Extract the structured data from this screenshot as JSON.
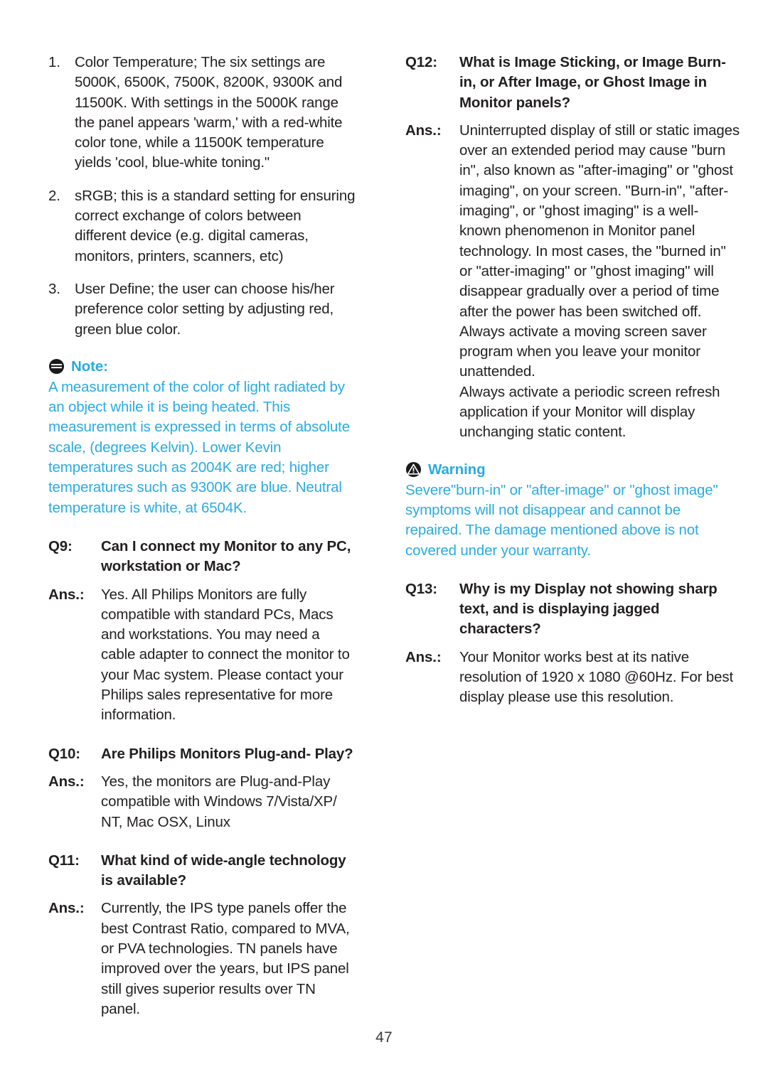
{
  "page": {
    "number": "47",
    "accent_color": "#29abe2",
    "text_color": "#231f20"
  },
  "left_column": {
    "numbered_list": [
      {
        "num": "1.",
        "text": "Color Temperature; The six settings are 5000K, 6500K, 7500K, 8200K, 9300K and 11500K. With settings in the 5000K range the panel appears 'warm,' with a red-white color tone, while a 11500K temperature yields 'cool, blue-white toning.\""
      },
      {
        "num": "2.",
        "text": "sRGB; this is a standard setting for ensuring correct exchange of colors between different device (e.g. digital cameras, monitors, printers, scanners, etc)"
      },
      {
        "num": "3.",
        "text": "User Define; the user can choose his/her preference color setting by adjusting red, green blue color."
      }
    ],
    "note": {
      "icon": "note-icon",
      "title": "Note:",
      "body": "A measurement of the color of light radiated by an object while it is being heated. This measurement is expressed in terms of absolute scale, (degrees Kelvin). Lower Kevin temperatures such as 2004K are red; higher temperatures such as 9300K are blue. Neutral temperature is white, at 6504K."
    },
    "qa": [
      {
        "q_label": "Q9:",
        "q_text": "Can I connect my Monitor to any PC, workstation or Mac?",
        "a_label": "Ans.:",
        "a_paragraphs": [
          "Yes. All Philips Monitors are fully compatible with standard PCs, Macs and workstations. You may need a cable adapter to connect the monitor to your Mac system. Please contact your Philips sales representative for more information."
        ]
      },
      {
        "q_label": "Q10:",
        "q_text": "Are Philips Monitors Plug-and- Play?",
        "a_label": "Ans.:",
        "a_paragraphs": [
          "Yes, the monitors are Plug-and-Play compatible with Windows 7/Vista/XP/ NT, Mac OSX, Linux"
        ]
      },
      {
        "q_label": "Q11:",
        "q_text": "What kind of wide-angle technology is available?",
        "a_label": "Ans.:",
        "a_paragraphs": [
          "Currently, the IPS type panels offer the best Contrast Ratio, compared to MVA, or PVA technologies. TN panels have improved over the years, but IPS panel still gives superior results over TN panel."
        ]
      }
    ]
  },
  "right_column": {
    "qa_top": {
      "q_label": "Q12:",
      "q_text": "What is Image Sticking, or Image Burn-in, or After Image, or Ghost Image in Monitor panels?",
      "a_label": "Ans.:",
      "a_paragraphs": [
        "Uninterrupted display of still or static images over an extended period may cause \"burn in\", also known as \"after-imaging\" or \"ghost imaging\", on your screen. \"Burn-in\", \"after-imaging\", or \"ghost imaging\" is a well-known phenomenon in Monitor panel technology. In most cases, the \"burned in\" or \"atter-imaging\" or \"ghost imaging\" will disappear gradually over a period of time after the power has been switched off.",
        "Always activate a moving screen saver program when you leave your monitor unattended.",
        "Always activate a periodic screen refresh application if your Monitor will display unchanging static content."
      ]
    },
    "warning": {
      "icon": "warning-icon",
      "title": "Warning",
      "body": "Severe\"burn-in\" or \"after-image\" or \"ghost image\" symptoms will not disappear and cannot be repaired. The damage mentioned above is not covered under your warranty."
    },
    "qa_bottom": {
      "q_label": "Q13:",
      "q_text": "Why is my Display not showing sharp text, and is displaying jagged characters?",
      "a_label": "Ans.:",
      "a_paragraphs": [
        "Your Monitor works best at its native resolution of 1920 x 1080 @60Hz. For best display please use this resolution."
      ]
    }
  }
}
